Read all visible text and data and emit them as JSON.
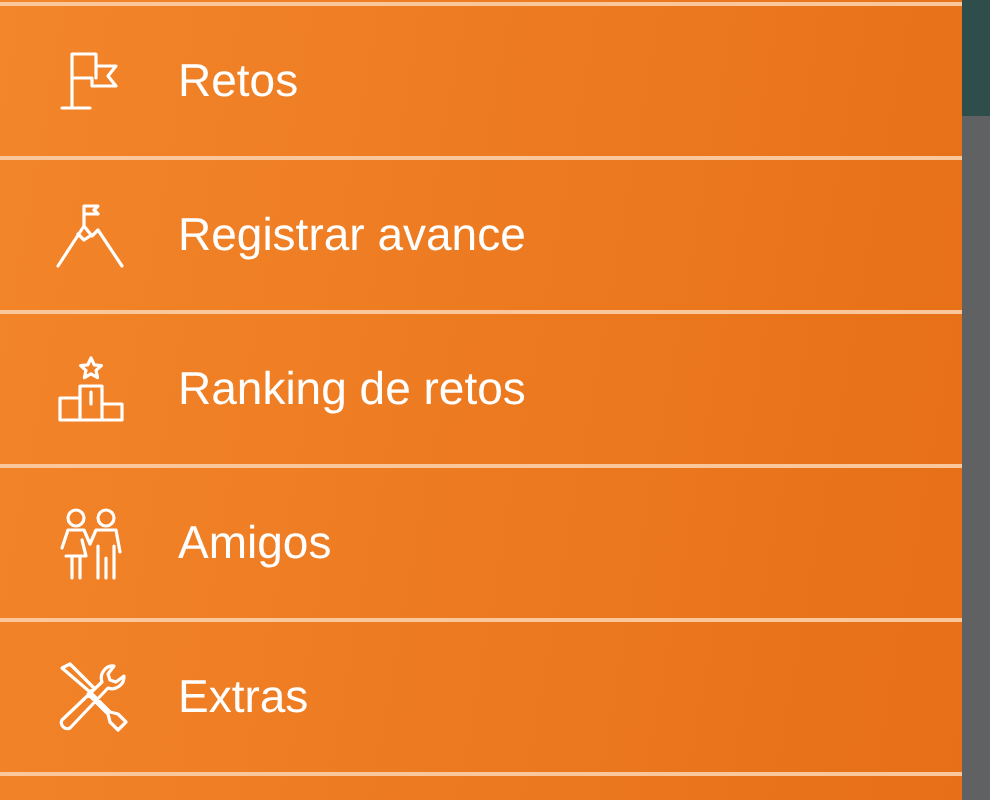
{
  "menu": {
    "items": [
      {
        "label": "Retos"
      },
      {
        "label": "Registrar avance"
      },
      {
        "label": "Ranking de retos"
      },
      {
        "label": "Amigos"
      },
      {
        "label": "Extras"
      }
    ]
  }
}
